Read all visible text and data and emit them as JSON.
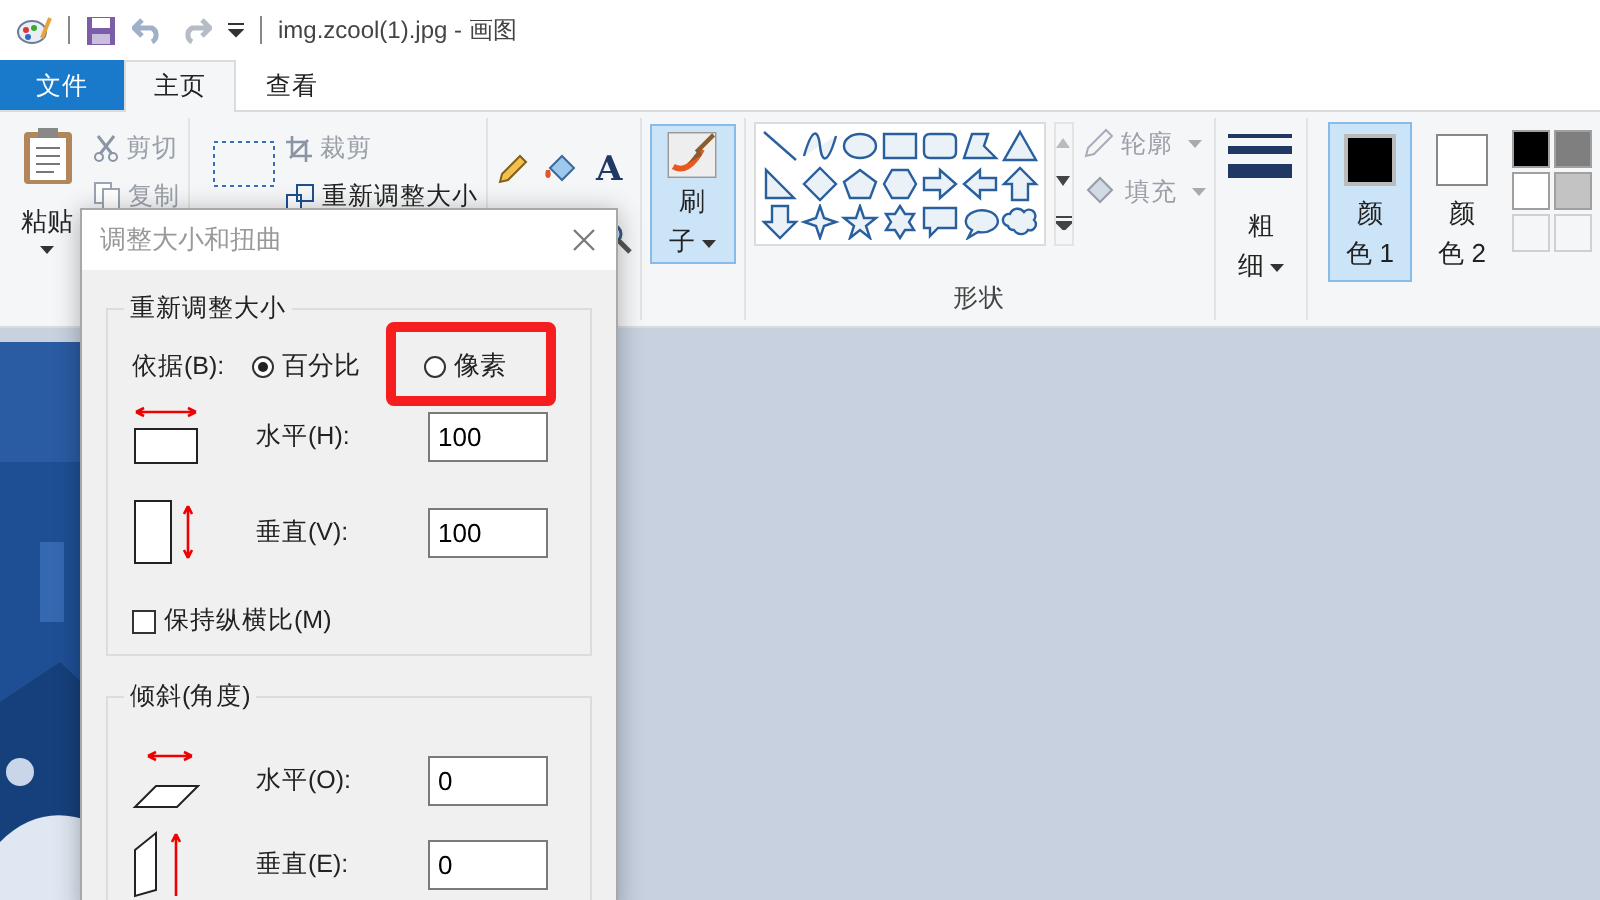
{
  "window": {
    "title": "img.zcool(1).jpg - 画图"
  },
  "tabs": [
    {
      "label": "文件",
      "kind": "file",
      "selected": false
    },
    {
      "label": "主页",
      "kind": "tab",
      "selected": true
    },
    {
      "label": "查看",
      "kind": "tab",
      "selected": false
    }
  ],
  "ribbon": {
    "text_tool": "A",
    "paste": "粘贴",
    "cut": "剪切",
    "copy": "复制",
    "crop": "裁剪",
    "resize": "重新调整大小",
    "brush": "刷子",
    "outline": "轮廓",
    "fill": "填充",
    "shapes_label": "形状",
    "size": "粗细",
    "colors": [
      {
        "label": "颜色 1",
        "selected": true,
        "color": "#000000"
      },
      {
        "label": "颜色 2",
        "selected": false,
        "color": "#ffffff"
      }
    ],
    "palette": [
      {
        "color": "#000000"
      },
      {
        "color": "#7f7f7f"
      },
      {
        "color": "#ffffff"
      },
      {
        "color": "#c3c3c3"
      }
    ]
  },
  "dialog": {
    "title": "调整大小和扭曲",
    "resize": {
      "legend": "重新调整大小",
      "by_label": "依据(B):",
      "options": [
        {
          "label": "百分比",
          "selected": true
        },
        {
          "label": "像素",
          "selected": false
        }
      ],
      "horizontal": {
        "label": "水平(H):",
        "value": "100"
      },
      "vertical": {
        "label": "垂直(V):",
        "value": "100"
      },
      "keep_ratio": {
        "label": "保持纵横比(M)",
        "checked": false
      }
    },
    "skew": {
      "legend": "倾斜(角度)",
      "horizontal": {
        "label": "水平(O):",
        "value": "0"
      },
      "vertical": {
        "label": "垂直(E):",
        "value": "0"
      }
    }
  }
}
